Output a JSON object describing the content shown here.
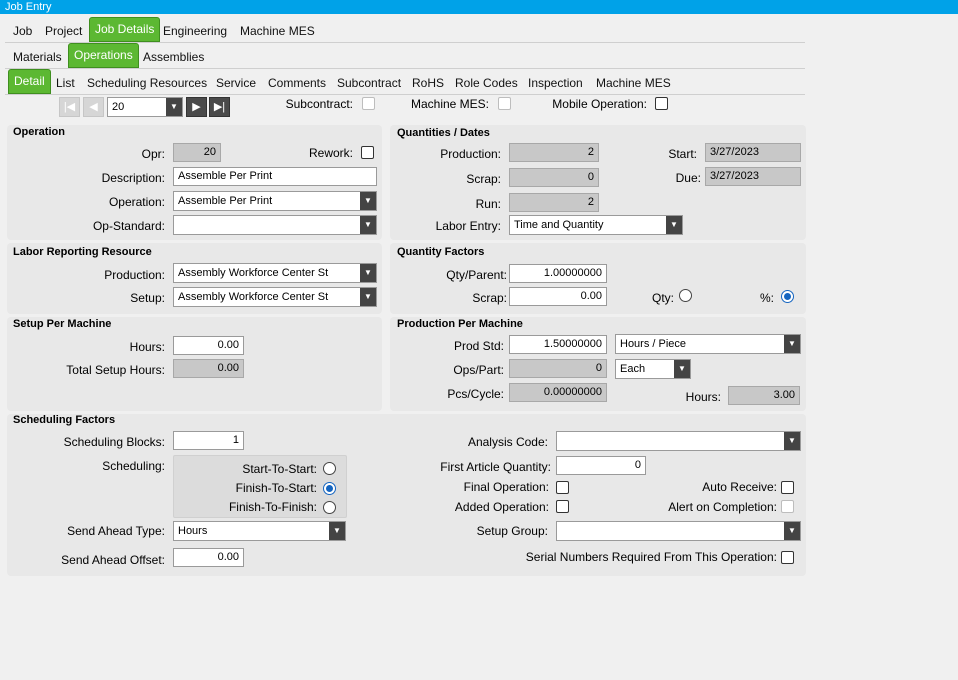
{
  "window": {
    "title": "Job Entry"
  },
  "tabs_l1": [
    "Job",
    "Project",
    "Job Details",
    "Engineering",
    "Machine MES"
  ],
  "tabs_l2": [
    "Materials",
    "Operations",
    "Assemblies"
  ],
  "tabs_l3": [
    "Detail",
    "List",
    "Scheduling Resources",
    "Service",
    "Comments",
    "Subcontract",
    "RoHS",
    "Role Codes",
    "Inspection",
    "Machine MES"
  ],
  "nav": {
    "first_icon": "first-record-icon",
    "prev_icon": "previous-record-icon",
    "next_icon": "next-record-icon",
    "last_icon": "last-record-icon",
    "record_value": "20"
  },
  "topflags": {
    "subcontract": "Subcontract:",
    "machine_mes": "Machine MES:",
    "mobile_operation": "Mobile Operation:"
  },
  "operation": {
    "title": "Operation",
    "opr_label": "Opr:",
    "opr_value": "20",
    "rework_label": "Rework:",
    "description_label": "Description:",
    "description_value": "Assemble Per Print",
    "operation_label": "Operation:",
    "operation_value": "Assemble Per Print",
    "opstandard_label": "Op-Standard:",
    "opstandard_value": ""
  },
  "quantities": {
    "title": "Quantities / Dates",
    "production_label": "Production:",
    "production_value": "2",
    "scrap_label": "Scrap:",
    "scrap_value": "0",
    "run_label": "Run:",
    "run_value": "2",
    "start_label": "Start:",
    "start_value": "3/27/2023",
    "due_label": "Due:",
    "due_value": "3/27/2023",
    "labor_entry_label": "Labor Entry:",
    "labor_entry_value": "Time and Quantity"
  },
  "labor": {
    "title": "Labor Reporting Resource",
    "production_label": "Production:",
    "production_value": "Assembly Workforce Center St",
    "setup_label": "Setup:",
    "setup_value": "Assembly Workforce Center St"
  },
  "qtyfactors": {
    "title": "Quantity Factors",
    "qtyparent_label": "Qty/Parent:",
    "qtyparent_value": "1.00000000",
    "scrap_label": "Scrap:",
    "scrap_value": "0.00",
    "qty_label": "Qty:",
    "pct_label": "%:"
  },
  "setup": {
    "title": "Setup Per Machine",
    "hours_label": "Hours:",
    "hours_value": "0.00",
    "total_label": "Total Setup Hours:",
    "total_value": "0.00"
  },
  "prod": {
    "title": "Production Per Machine",
    "prodstd_label": "Prod Std:",
    "prodstd_value": "1.50000000",
    "prodstd_unit": "Hours / Piece",
    "opspart_label": "Ops/Part:",
    "opspart_value": "0",
    "opspart_unit": "Each",
    "pcscycle_label": "Pcs/Cycle:",
    "pcscycle_value": "0.00000000",
    "hours_label": "Hours:",
    "hours_value": "3.00"
  },
  "sched": {
    "title": "Scheduling Factors",
    "blocks_label": "Scheduling Blocks:",
    "blocks_value": "1",
    "scheduling_label": "Scheduling:",
    "sts": "Start-To-Start:",
    "fts": "Finish-To-Start:",
    "ftf": "Finish-To-Finish:",
    "sendahead_type_label": "Send Ahead Type:",
    "sendahead_type_value": "Hours",
    "sendahead_offset_label": "Send Ahead Offset:",
    "sendahead_offset_value": "0.00",
    "analysis_label": "Analysis Code:",
    "analysis_value": "",
    "firstarticle_label": "First Article Quantity:",
    "firstarticle_value": "0",
    "final_label": "Final Operation:",
    "autoreceive_label": "Auto Receive:",
    "added_label": "Added Operation:",
    "alert_label": "Alert on Completion:",
    "setupgroup_label": "Setup Group:",
    "setupgroup_value": "",
    "serial_label": "Serial Numbers Required From This Operation:"
  }
}
